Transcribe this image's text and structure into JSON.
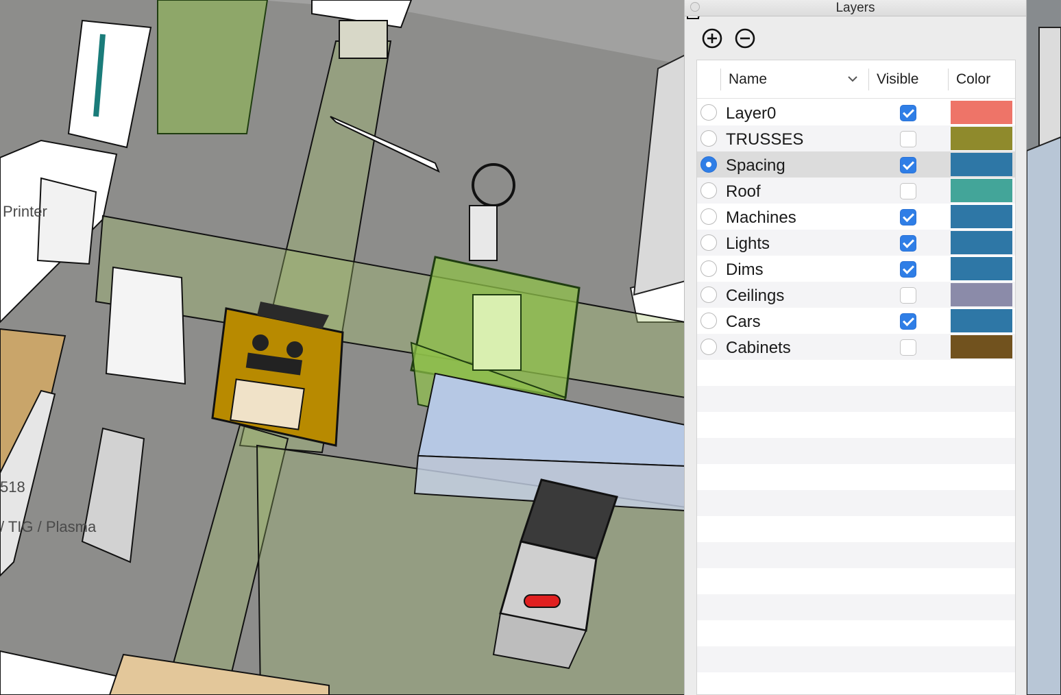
{
  "viewport": {
    "labels": [
      "Printer",
      "518",
      "/ TIG / Plasma"
    ]
  },
  "panel": {
    "title": "Layers",
    "toolbar": {
      "add_icon": "plus-circle-icon",
      "remove_icon": "minus-circle-icon",
      "details_icon": "details-arrow-icon"
    },
    "columns": {
      "name": "Name",
      "visible": "Visible",
      "color": "Color"
    },
    "layers": [
      {
        "name": "Layer0",
        "visible": true,
        "active": false,
        "color": "#ee7468"
      },
      {
        "name": "TRUSSES",
        "visible": false,
        "active": false,
        "color": "#8f8a2c"
      },
      {
        "name": "Spacing",
        "visible": true,
        "active": true,
        "color": "#2e77a6"
      },
      {
        "name": "Roof",
        "visible": false,
        "active": false,
        "color": "#43a599"
      },
      {
        "name": "Machines",
        "visible": true,
        "active": false,
        "color": "#2e77a6"
      },
      {
        "name": "Lights",
        "visible": true,
        "active": false,
        "color": "#2e77a6"
      },
      {
        "name": "Dims",
        "visible": true,
        "active": false,
        "color": "#2e77a6"
      },
      {
        "name": "Ceilings",
        "visible": false,
        "active": false,
        "color": "#8b8ba9"
      },
      {
        "name": "Cars",
        "visible": true,
        "active": false,
        "color": "#2e77a6"
      },
      {
        "name": "Cabinets",
        "visible": false,
        "active": false,
        "color": "#71521e"
      }
    ]
  }
}
